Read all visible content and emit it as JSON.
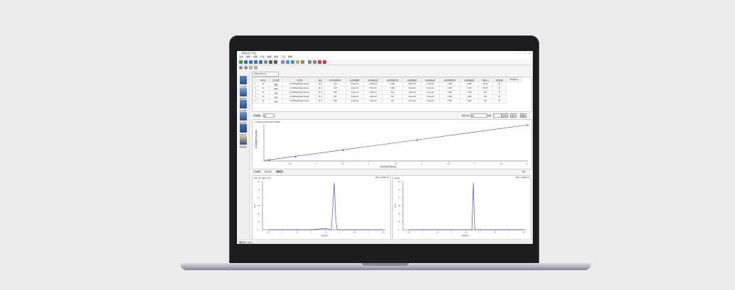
{
  "window": {
    "title": "液相色谱工作站-",
    "min": "–",
    "max": "□",
    "close": "×"
  },
  "menu": [
    "文件",
    "编辑",
    "视图",
    "方法",
    "数据",
    "报告",
    "工具",
    "帮助"
  ],
  "toolbar_icon_colors": [
    "#3a9a3a",
    "#3b6fc9",
    "#3b6fc9",
    "#3b6fc9",
    "#3b6fc9",
    "#888888",
    "#5a5a5a",
    "#5a5a5a",
    "#b36bd4",
    "#4a90d9",
    "#4a90d9",
    "#d9a441",
    "#888888",
    "#888888",
    "#888888",
    "#d43a3a",
    "#d43a3a"
  ],
  "sidebar": [
    {
      "label": "方法管理",
      "color": "#4e86c9"
    },
    {
      "label": "数据处理",
      "color": "#7aa3d6"
    },
    {
      "label": "样品管理",
      "color": "#5b88c8"
    },
    {
      "label": "报告管理",
      "color": "#6f9bd3"
    },
    {
      "label": "定量分析",
      "color": "#3f6fb3"
    },
    {
      "label": "系统管理",
      "color": "#d6c37a"
    }
  ],
  "doc_tab": {
    "label": "HBFA-2024-01",
    "close": "×"
  },
  "table": {
    "headers": [
      "",
      "峰号名",
      "定义类型",
      "化合物",
      "峰宽",
      "标准1保留时间",
      "标准1峰面积",
      "标准1峰高度",
      "标准2保留时间",
      "标准2峰面积",
      "标准2峰高度",
      "标准3保留时间",
      "标准3峰面积",
      "定量方法",
      "相关系数",
      "Pro(M) mr"
    ],
    "rows": [
      [
        "1",
        "01",
        "峰值",
        "D-CMPeak(Safe) Area(v)",
        "Mr 1",
        "2.65",
        "2.45e+04",
        "1.98e+03",
        "2.065",
        "2.85e+03",
        "1.34e+03",
        "1.065",
        "1.862",
        "99.14",
        "☒"
      ],
      [
        "2",
        "02",
        "峰值",
        "D-CMPeak(Safe) Area(v)",
        "Mr 1",
        "2.65",
        "6.22e+04",
        "3.87e+03",
        "3.065",
        "3.87e+03",
        "1.34e+03",
        "1.065",
        "5.146",
        "102.87",
        "☒"
      ],
      [
        "3",
        "11",
        "标准",
        "D-CMPeak(Safe) Area(v)",
        "Mr 1",
        "2.86",
        "1.23e+04",
        "9.78e+03",
        "N/A",
        "1.98e+03",
        "1.34e+03",
        "1.065",
        "1.065",
        "N/A",
        "☒"
      ],
      [
        "4",
        "12",
        "标准",
        "D-CMPeak(Safe) Area(v)",
        "Mr 1",
        "2.87",
        "1.12e+04",
        "1.04e+03",
        "N/A",
        "2.41e+03",
        "1.34e+03",
        "1.065",
        "1.065",
        "N/A",
        "☒"
      ],
      [
        "5",
        "05",
        "标准",
        "D-CMPeak(Safe) Area(v)",
        "Mr 1",
        "2.88",
        "2.38e+04",
        "1.94e+03",
        "N/A",
        "2.41e+03",
        "1.34e+03",
        "1.065",
        "1.865",
        "N/A",
        "☒"
      ]
    ]
  },
  "controls": {
    "sample_label": "样品数据:",
    "sample_value": "峰1",
    "fit_label": "拟合方式:",
    "fit_value": "线性",
    "weight_label": "权重:",
    "weight_value": "1",
    "apply_button": "应用",
    "origin_button": "原点",
    "refresh_button": "刷新"
  },
  "calibration": {
    "equation": "y=1.8661x+0.0013 (R2=0.9988)",
    "ylabel": "相对峰面积(样品/内标)",
    "xlabel": "相对浓度(样品/内标)",
    "ticks": [
      "0.5",
      "1",
      "1.5",
      "2",
      "2.5",
      "3",
      "3.5",
      "4",
      "4.5",
      "5"
    ]
  },
  "chart_data": [
    {
      "type": "scatter",
      "title": "",
      "xlabel": "相对浓度(样品/内标)",
      "ylabel": "相对峰面积(样品/内标)",
      "x": [
        0.1,
        0.6,
        1.5,
        2.9,
        5.0
      ],
      "y": [
        0.2,
        1.1,
        2.8,
        5.4,
        9.3
      ],
      "xlim": [
        0,
        5
      ],
      "ylim": [
        0,
        9.6
      ],
      "fit_line": true
    },
    {
      "type": "line",
      "xlabel": "时间/min",
      "ylabel": "mAU",
      "x": [
        0.5,
        1,
        1.5,
        2,
        2.5,
        2.7,
        2.8,
        2.85,
        2.9,
        3,
        3.5,
        4,
        4.5
      ],
      "y": [
        0,
        0,
        0,
        0,
        0.05,
        0,
        1.75,
        0.4,
        0,
        0,
        0,
        0,
        0
      ],
      "xlim": [
        0.3,
        4.6
      ],
      "ylim": [
        0,
        1.8
      ]
    },
    {
      "type": "line",
      "xlabel": "时间/min",
      "ylabel": "mAU",
      "x": [
        0.5,
        1,
        1.5,
        2,
        2.5,
        2.7,
        2.75,
        2.8,
        3,
        3.5,
        4,
        4.5
      ],
      "y": [
        0,
        0,
        0,
        0,
        0,
        0,
        1.75,
        0,
        0,
        0,
        0,
        0
      ],
      "xlim": [
        0.3,
        4.6
      ],
      "ylim": [
        0,
        1.8
      ]
    }
  ],
  "subtabs": [
    "标准曲线",
    "校正因子",
    "谱图显示",
    "全屏"
  ],
  "chromo_left": {
    "header": "样本: S1, 分析号: Mr 1",
    "header_right": "Map 1_2std01.xpl",
    "yticks": [
      "0",
      "0.3",
      "0.6",
      "0.9",
      "1.2",
      "1.5",
      "1.8"
    ],
    "xticks": [
      "0.5",
      "1",
      "1.5",
      "2",
      "2.5",
      "3",
      "3.5",
      "4",
      "4.5"
    ],
    "xlabel": "时间/min",
    "ylabel": "mAU"
  },
  "chromo_right": {
    "header": "分析号:",
    "header_right": "Map 1_2std02.xpl",
    "yticks": [
      "0",
      "0.3",
      "0.6",
      "0.9",
      "1.2",
      "1.5",
      "1.8"
    ],
    "xticks": [
      "0.5",
      "1",
      "1.5",
      "2",
      "2.5",
      "3",
      "3.5",
      "4",
      "4.5"
    ],
    "xlabel": "时间/min",
    "ylabel": "mAU"
  },
  "status": {
    "text": "当前用户: admin",
    "grip": "◢"
  }
}
